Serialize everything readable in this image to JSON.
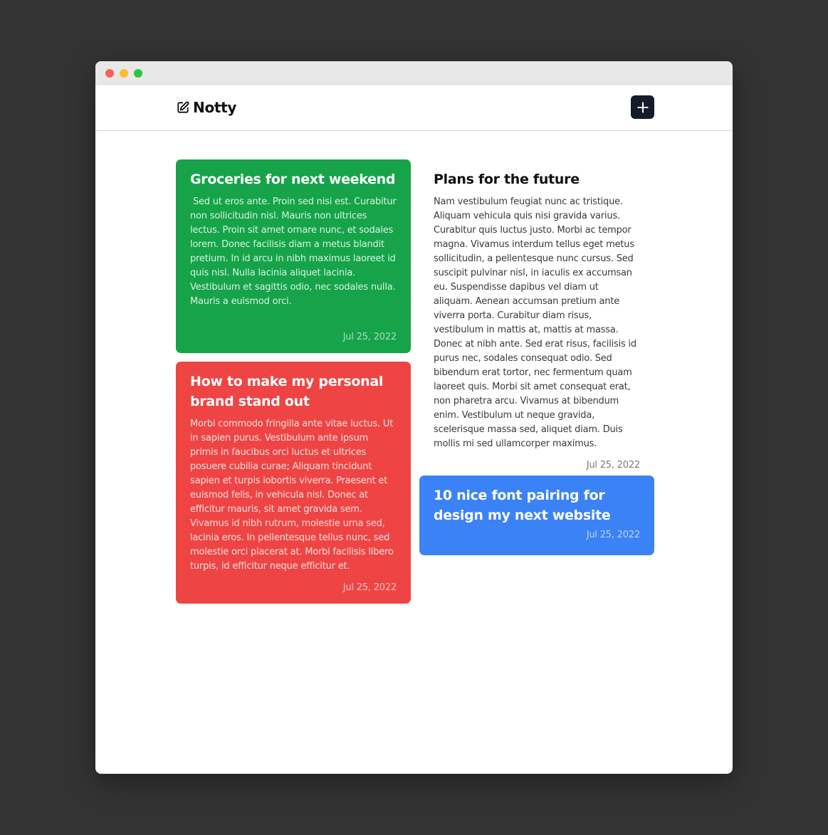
{
  "window": {
    "controls": [
      {
        "name": "close",
        "color": "#ff5f57"
      },
      {
        "name": "minimize",
        "color": "#febc2e"
      },
      {
        "name": "maximize",
        "color": "#28c840"
      }
    ]
  },
  "header": {
    "brand_icon": "edit-note-icon",
    "title": "Notty",
    "add_button_icon": "plus-icon"
  },
  "colors": {
    "green": "#16a34a",
    "red": "#ef4444",
    "white": "#ffffff",
    "blue": "#3b82f6",
    "dark": "#141b2a"
  },
  "notes": [
    {
      "title": "Groceries for next weekend",
      "body": " Sed ut eros ante. Proin sed nisi est. Curabitur non sollicitudin nisl. Mauris non ultrices lectus. Proin sit amet ornare nunc, et sodales lorem. Donec facilisis diam a metus blandit pretium. In id arcu in nibh maximus laoreet id quis nisl. Nulla lacinia aliquet lacinia. Vestibulum et sagittis odio, nec sodales nulla. Mauris a euismod orci.",
      "date": "Jul 25, 2022",
      "color": "green"
    },
    {
      "title": "How to make my personal brand stand out",
      "body": "Morbi commodo fringilla ante vitae luctus. Ut in sapien purus. Vestibulum ante ipsum primis in faucibus orci luctus et ultrices posuere cubilia curae; Aliquam tincidunt sapien et turpis lobortis viverra. Praesent et euismod felis, in vehicula nisl. Donec at efficitur mauris, sit amet gravida sem. Vivamus id nibh rutrum, molestie urna sed, lacinia eros. In pellentesque tellus nunc, sed molestie orci placerat at. Morbi facilisis libero turpis, id efficitur neque efficitur et.",
      "date": "Jul 25, 2022",
      "color": "red"
    },
    {
      "title": "Plans for the future",
      "body": "Nam vestibulum feugiat nunc ac tristique. Aliquam vehicula quis nisi gravida varius. Curabitur quis luctus justo. Morbi ac tempor magna. Vivamus interdum tellus eget metus sollicitudin, a pellentesque nunc cursus. Sed suscipit pulvinar nisl, in iaculis ex accumsan eu. Suspendisse dapibus vel diam ut aliquam. Aenean accumsan pretium ante viverra porta. Curabitur diam risus, vestibulum in mattis at, mattis at massa. Donec at nibh ante. Sed erat risus, facilisis id purus nec, sodales consequat odio. Sed bibendum erat tortor, nec fermentum quam laoreet quis. Morbi sit amet consequat erat, non pharetra arcu. Vivamus at bibendum enim. Vestibulum ut neque gravida, scelerisque massa sed, aliquet diam. Duis mollis mi sed ullamcorper maximus.",
      "date": "Jul 25, 2022",
      "color": "white"
    },
    {
      "title": "10 nice font pairing for design my next website",
      "body": "",
      "date": "Jul 25, 2022",
      "color": "blue"
    }
  ]
}
